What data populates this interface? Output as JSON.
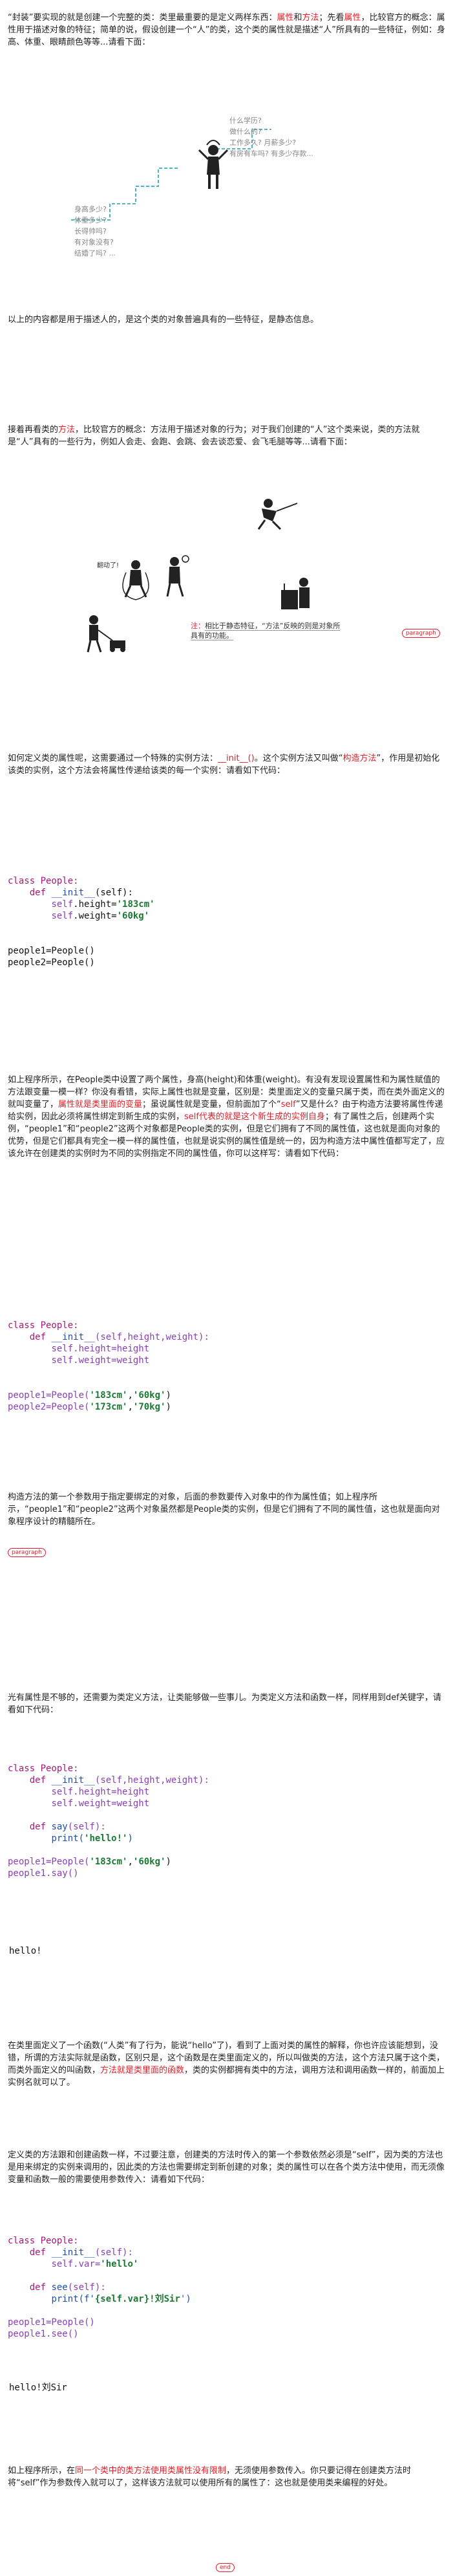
{
  "intro": {
    "part1": "“封装”要实现的就是创建一个完整的类：类里最重要的是定义两样东西：",
    "red1": "属性",
    "mid1": "和",
    "red2": "方法",
    "part2": "；先看",
    "red3": "属性",
    "part3": "，比较官方的概念：属性用于描述对象的特征；简单的说，假设创建一个“人”的类，这个类的属性就是描述“人”所具有的一些特征，例如：身高、体重、眼睛颜色等等...请看下面："
  },
  "figure1": {
    "right_lines": [
      "什么学历?",
      "做什么的?",
      "工作多久? 月薪多少?",
      "有房有车吗? 有多少存款..."
    ],
    "left_lines": [
      "身高多少?",
      "体重多少?",
      "长得帅吗?",
      "有对象没有?",
      "结婚了吗? ..."
    ]
  },
  "p_summary": "以上的内容都是用于描述人的，是这个类的对象普遍具有的一些特征，是静态信息。",
  "p_method": {
    "part1": "接着再看类的",
    "red1": "方法",
    "part2": "，比较官方的概念：方法用于描述对象的行为；对于我们创建的“人”这个类来说，类的方法就是“人”具有的一些行为，例如人会走、会跑、会跳、会去谈恋爱、会飞毛腿等等...请看下面："
  },
  "figure2": {
    "bubble": "翻动了!",
    "note_label": "注：",
    "note_text": "相比于静态特征，“方法”反映的则是对象所具有的功能。"
  },
  "tag_label": "paragraph",
  "end_label": "end",
  "p_init": {
    "part1": "如何定义类的属性呢，这需要通过一个特殊的实例方法：",
    "red1": "__init__()",
    "part2": "。这个实例方法又叫做“",
    "red2": "构造方法",
    "part3": "”，作用是初始化该类的实例，这个方法会将属性传递给该类的每一个实例：请看如下代码："
  },
  "code1": {
    "line1": "class People:",
    "line2_kw": "def",
    "line2_fn": "__init__",
    "line2_rest": "(self):",
    "line3_self": "self",
    "line3_rest": ".height=",
    "line3_str": "'183cm'",
    "line4_self": "self",
    "line4_rest": ".weight=",
    "line4_str": "'60kg'",
    "line5": "people1=People()",
    "line6": "people2=People()"
  },
  "p_explain": {
    "part1": "如上程序所示，在People类中设置了两个属性，身高(height)和体重(weight)。有没有发现设置属性和为属性赋值的方法跟变量一模一样？你没有看错，实际上属性也就是变量，区别是：类里面定义的变量只属于类，而在类外面定义的就叫变量了，",
    "red1": "属性就是类里面的变量",
    "part2": "；虽说属性就是变量，但前面加了个“",
    "red2": "self",
    "part3": "”又是什么？由于构造方法要将属性传递给实例，因此必须将属性绑定到新生成的实例，",
    "red3": "self代表的就是这个新生成的实例自身",
    "part4": "；有了属性之后，创建两个实例，“people1”和“people2”这两个对象都是People类的实例，但是它们拥有了不同的属性值，这也就是面向对象的优势，但是它们都具有完全一模一样的属性值，也就是说实例的属性值是统一的，因为构造方法中属性值都写定了，应该允许在创建类的实例时为不同的实例指定不同的属性值，你可以这样写：请看如下代码："
  },
  "code2": {
    "line1": "class People:",
    "line2_kw": "def",
    "line2_fn": "__init__",
    "line2_rest": "(self,height,weight):",
    "line3": "self.height=height",
    "line4": "self.weight=weight",
    "line5_a": "people1=People(",
    "line5_b": "'183cm'",
    "line5_c": ",",
    "line5_d": "'60kg'",
    "line5_e": ")",
    "line6_a": "people2=People(",
    "line6_b": "'173cm'",
    "line6_c": ",",
    "line6_d": "'70kg'",
    "line6_e": ")"
  },
  "p_args": "构造方法的第一个参数用于指定要绑定的对象，后面的参数要传入对象中的作为属性值；如上程序所示，“people1”和“people2”这两个对象虽然都是People类的实例，但是它们拥有了不同的属性值，这也就是面向对象程序设计的精髓所在。",
  "p_self": "光有属性是不够的，还需要为类定义方法，让类能够做一些事儿。为类定义方法和函数一样，同样用到def关键字，请看如下代码：",
  "code3": {
    "line1": "class People:",
    "line2_kw": "def",
    "line2_fn": "__init__",
    "line2_rest": "(self,height,weight):",
    "line3": "self.height=height",
    "line4": "self.weight=weight",
    "line5_kw": "def",
    "line5_fn": "say",
    "line5_rest": "(self):",
    "line6_a": "print(",
    "line6_b": "'hello!'",
    "line6_c": ")",
    "line7_a": "people1=People(",
    "line7_b": "'183cm'",
    "line7_c": ",",
    "line7_d": "'60kg'",
    "line7_e": ")",
    "line8": "people1.say()"
  },
  "out1": "hello!",
  "p_func": {
    "part1": "在类里面定义了一个函数(“人类”有了行为，能说“hello”了)，看到了上面对类的属性的解释，你也许应该能想到，没错，所谓的方法实际就是函数，区别只是，这个函数是在类里面定义的，所以叫做类的方法，这个方法只属于这个类，而类外面定义的叫函数，",
    "red1": "方法就是类里面的函数",
    "part2": "，类的实例都拥有类中的方法，调用方法和调用函数一样的，前面加上实例名就可以了。"
  },
  "p_param": "定义类的方法跟和创建函数一样，不过要注意，创建类的方法时传入的第一个参数依然必须是“self”，因为类的方法也是用来绑定的实例来调用的，因此类的方法也需要绑定到新创建的对象；类的属性可以在各个类方法中使用，而无须像变量和函数一般的需要使用参数传入：请看如下代码：",
  "code4": {
    "line1": "class People:",
    "line2_kw": "def",
    "line2_fn": "__init__",
    "line2_rest": "(self):",
    "line3_a": "self.var=",
    "line3_b": "'hello'",
    "line4_kw": "def",
    "line4_fn": "see",
    "line4_rest": "(self):",
    "line5_a": "print(f'",
    "line5_b": "{self.var}!刘Sir",
    "line5_c": "')",
    "line6": "people1=People()",
    "line7": "people1.see()"
  },
  "out2": "hello!刘Sir",
  "p_final": {
    "part1": "如上程序所示，在",
    "red1": "同一个类中的类方法使用类属性没有限制",
    "part2": "，无须使用参数传入。你只要记得在创建类方法时将“self”作为参数传入就可以了，这样该方法就可以使用所有的属性了：这也就是使用类来编程的好处。"
  }
}
